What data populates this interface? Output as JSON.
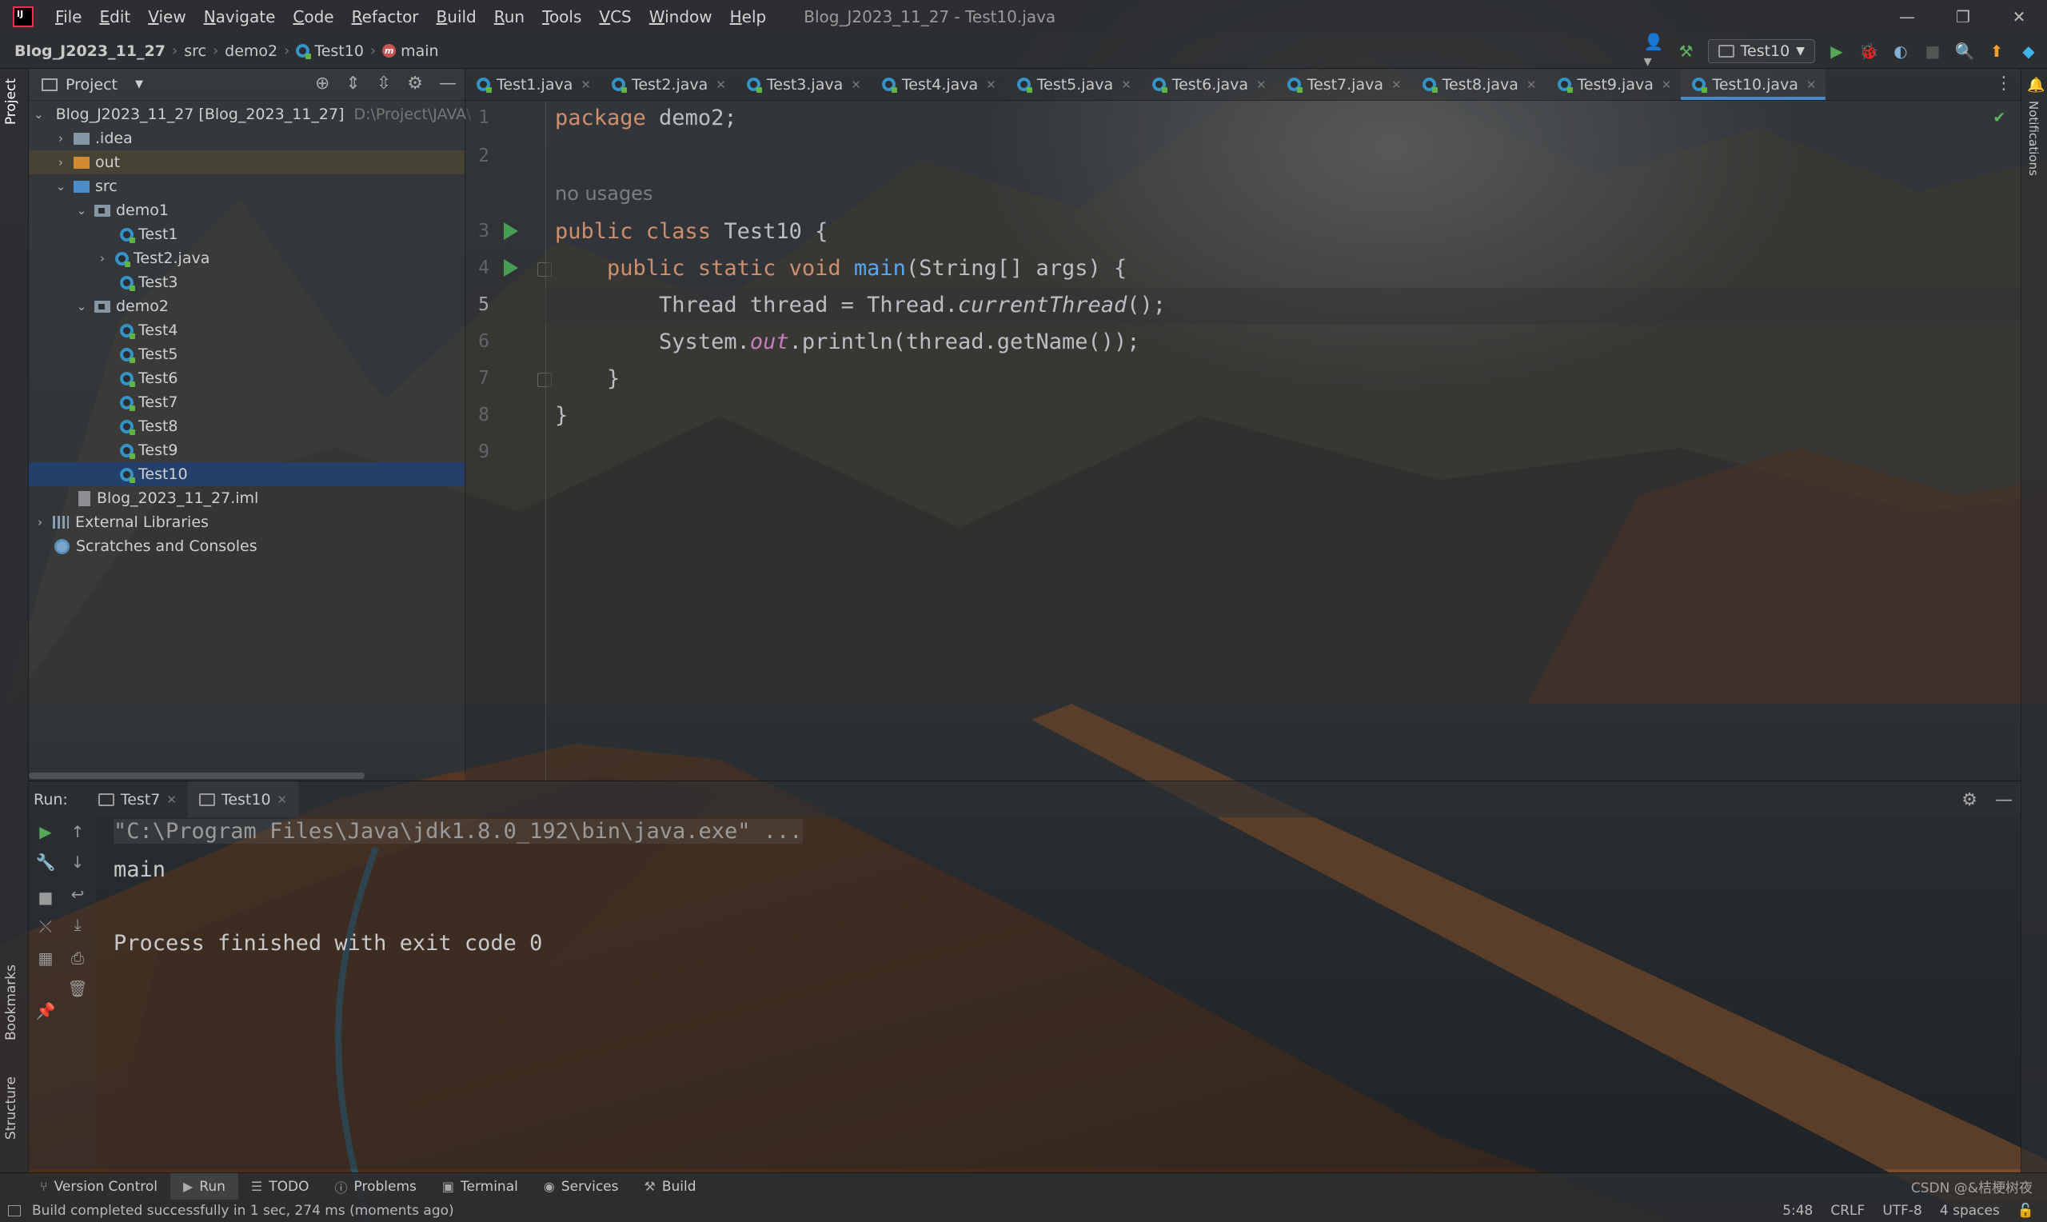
{
  "window": {
    "title": "Blog_J2023_11_27 - Test10.java",
    "menu": [
      "File",
      "Edit",
      "View",
      "Navigate",
      "Code",
      "Refactor",
      "Build",
      "Run",
      "Tools",
      "VCS",
      "Window",
      "Help"
    ],
    "controls": [
      "—",
      "❐",
      "✕"
    ]
  },
  "navbar": {
    "breadcrumbs": [
      "Blog_J2023_11_27",
      "src",
      "demo2",
      "Test10",
      "main"
    ],
    "run_config": "Test10"
  },
  "left_stripe": {
    "project": "Project",
    "bookmarks": "Bookmarks",
    "structure": "Structure"
  },
  "right_stripe": {
    "notifications": "Notifications"
  },
  "project_panel": {
    "title": "Project",
    "root_label": "Blog_J2023_11_27 [Blog_2023_11_27]",
    "root_path": "D:\\Project\\JAVA\\",
    "idea": ".idea",
    "out": "out",
    "src": "src",
    "demo1": "demo1",
    "demo1_files": [
      "Test1",
      "Test2.java",
      "Test3"
    ],
    "demo2": "demo2",
    "demo2_files": [
      "Test4",
      "Test5",
      "Test6",
      "Test7",
      "Test8",
      "Test9",
      "Test10"
    ],
    "iml": "Blog_2023_11_27.iml",
    "external_libraries": "External Libraries",
    "scratches": "Scratches and Consoles"
  },
  "editor": {
    "tabs": [
      "Test1.java",
      "Test2.java",
      "Test3.java",
      "Test4.java",
      "Test5.java",
      "Test6.java",
      "Test7.java",
      "Test8.java",
      "Test9.java",
      "Test10.java"
    ],
    "active_tab": "Test10.java",
    "line_numbers": [
      "1",
      "2",
      "3",
      "4",
      "5",
      "6",
      "7",
      "8",
      "9"
    ],
    "current_line": "5",
    "inlay_hint": "no usages",
    "code": {
      "l1_kw": "package",
      "l1_rest": " demo2;",
      "l3_kw": "public class",
      "l3_rest": " Test10 {",
      "l4_kw": "public static void",
      "l4_fn": "main",
      "l4_rest": "(String[] args) {",
      "l5_a": "Thread thread = Thread.",
      "l5_it": "currentThread",
      "l5_b": "();",
      "l6_a": "System.",
      "l6_st": "out",
      "l6_b": ".println(thread.getName());",
      "l7": "}",
      "l8": "}"
    }
  },
  "run_panel": {
    "label": "Run:",
    "tabs": [
      "Test7",
      "Test10"
    ],
    "console": [
      "\"C:\\Program Files\\Java\\jdk1.8.0_192\\bin\\java.exe\" ...",
      "main",
      "",
      "Process finished with exit code 0"
    ]
  },
  "toolwindows": [
    "Version Control",
    "Run",
    "TODO",
    "Problems",
    "Terminal",
    "Services",
    "Build"
  ],
  "status": {
    "message": "Build completed successfully in 1 sec, 274 ms (moments ago)",
    "position": "5:48",
    "line_sep": "CRLF",
    "encoding": "UTF-8",
    "indent": "4 spaces",
    "watermark": "CSDN @&桔梗树夜"
  },
  "colors": {
    "accent": "#4a88c7",
    "run_green": "#499c54",
    "keyword": "#cf8e6d",
    "function": "#56a8f5",
    "static_field": "#c77dbb"
  }
}
